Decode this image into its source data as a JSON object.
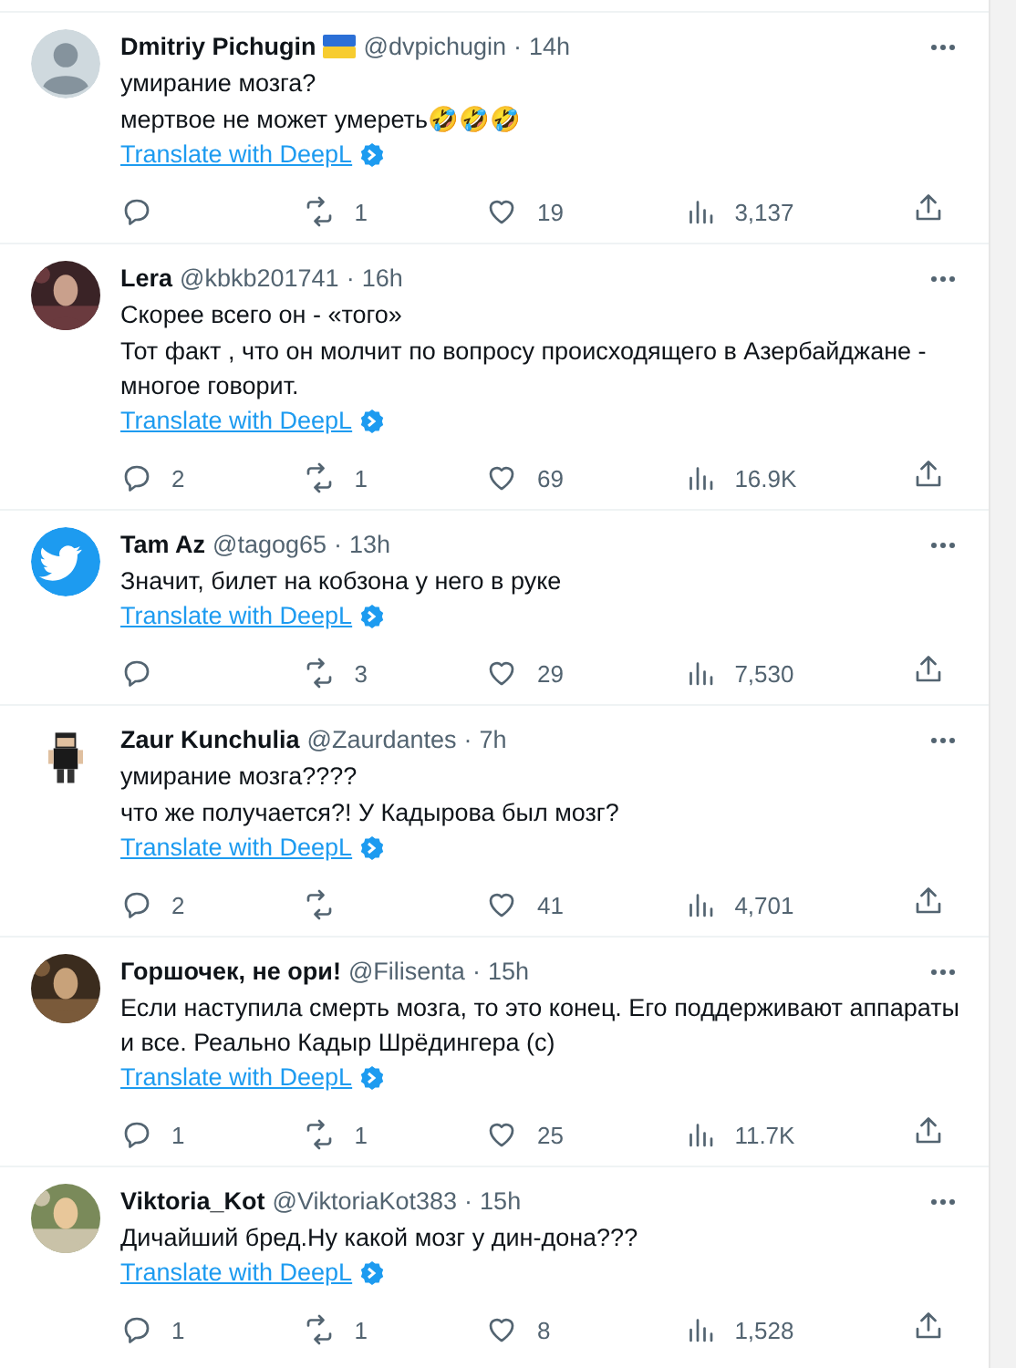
{
  "replies": [
    {
      "avatar": {
        "kind": "default"
      },
      "name": "Dmitriy Pichugin",
      "flag": true,
      "handle": "@dvpichugin",
      "dot": "·",
      "time": "14h",
      "text": [
        "умирание мозга?",
        "мертвое не может умереть🤣🤣🤣"
      ],
      "translate": "Translate with DeepL",
      "reposts": "1",
      "likes": "19",
      "views": "3,137"
    },
    {
      "avatar": {
        "kind": "picture"
      },
      "name": "Lera",
      "handle": "@kbkb201741",
      "dot": "·",
      "time": "16h",
      "text": [
        "Скорее всего он - «того»",
        "Тот факт , что он молчит по вопросу происходящего в Азербайджане - многое говорит."
      ],
      "translate": "Translate with DeepL",
      "replies": "2",
      "reposts": "1",
      "likes": "69",
      "views": "16.9K"
    },
    {
      "avatar": {
        "kind": "bird"
      },
      "name": "Tam Az",
      "handle": "@tagog65",
      "dot": "·",
      "time": "13h",
      "text": [
        "Значит, билет на кобзона у него в руке"
      ],
      "translate": "Translate with DeepL",
      "reposts": "3",
      "likes": "29",
      "views": "7,530"
    },
    {
      "avatar": {
        "kind": "pixel"
      },
      "name": "Zaur Kunchulia",
      "handle": "@Zaurdantes",
      "dot": "·",
      "time": "7h",
      "text": [
        "умирание мозга????",
        "что же получается?! У Кадырова был мозг?"
      ],
      "translate": "Translate with DeepL",
      "replies": "2",
      "likes": "41",
      "views": "4,701"
    },
    {
      "avatar": {
        "kind": "picture"
      },
      "name": "Горшочек, не ори!",
      "handle": "@Filisenta",
      "dot": "·",
      "time": "15h",
      "text": [
        "Если наступила смерть мозга, то это конец. Его поддерживают аппараты и все. Реально Кадыр Шрёдингера (с)"
      ],
      "translate": "Translate with DeepL",
      "replies": "1",
      "reposts": "1",
      "likes": "25",
      "views": "11.7K"
    },
    {
      "avatar": {
        "kind": "picture"
      },
      "name": "Viktoria_Kot",
      "handle": "@ViktoriaKot383",
      "dot": "·",
      "time": "15h",
      "text": [
        "Дичайший бред.Ну какой мозг у дин-дона???"
      ],
      "translate": "Translate with DeepL",
      "replies": "1",
      "reposts": "1",
      "likes": "8",
      "views": "1,528"
    }
  ]
}
